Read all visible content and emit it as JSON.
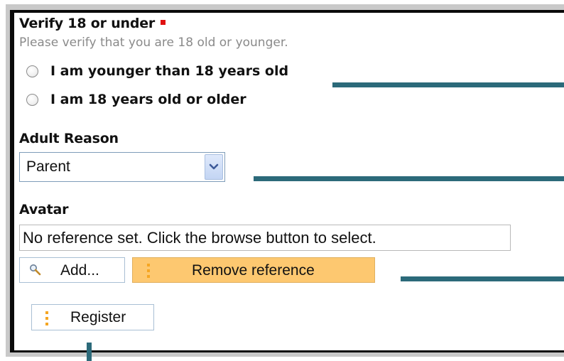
{
  "verify": {
    "label": "Verify 18 or under",
    "hint": "Please verify that you are 18 old or younger.",
    "options": [
      {
        "label": "I am younger than 18 years old",
        "selected": false
      },
      {
        "label": "I am 18 years old or older",
        "selected": false
      }
    ]
  },
  "adult_reason": {
    "label": "Adult Reason",
    "selected": "Parent"
  },
  "avatar": {
    "label": "Avatar",
    "reference_text": "No reference set. Click the browse button to select.",
    "add_label": "Add...",
    "remove_label": "Remove reference"
  },
  "register_label": "Register",
  "colors": {
    "required_marker": "#e01010",
    "remove_button": "#fdc870",
    "callout_lines": "#2c6a7a",
    "hint_text": "#8a8a8a"
  },
  "icons": [
    "required-marker-icon",
    "radio-icon",
    "chevron-down-icon",
    "magnifier-icon",
    "dots-icon"
  ]
}
